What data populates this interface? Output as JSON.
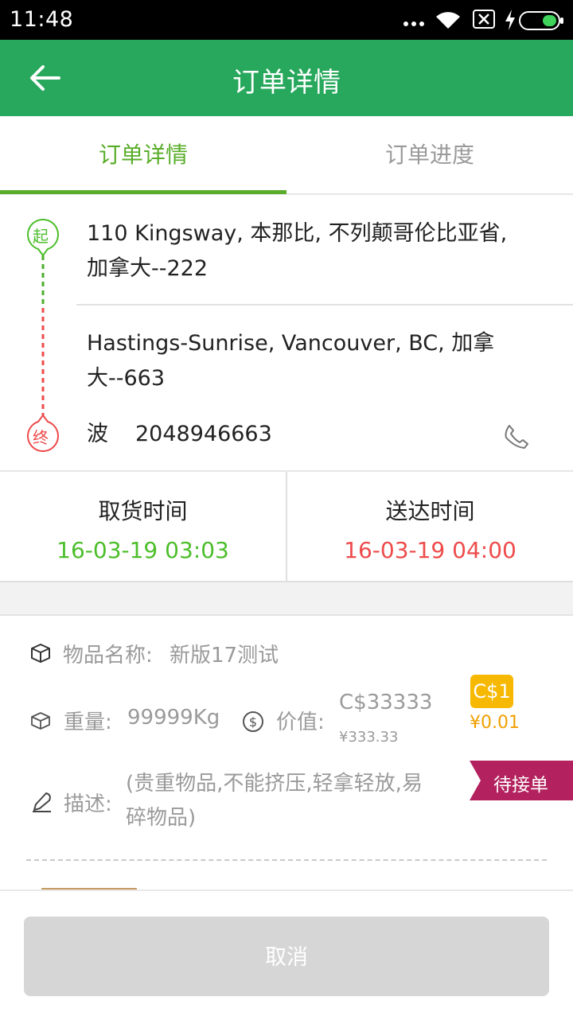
{
  "status_bar": {
    "time": "11:48"
  },
  "header": {
    "title": "订单详情"
  },
  "tabs": [
    {
      "label": "订单详情",
      "active": true
    },
    {
      "label": "订单进度",
      "active": false
    }
  ],
  "route": {
    "start_marker": "起",
    "end_marker": "终",
    "pickup_address": [
      "110 Kingsway, 本那比, 不列颠哥伦比亚省,",
      "加拿大--222"
    ],
    "delivery_address": [
      "Hastings-Sunrise, Vancouver, BC, 加拿",
      "大--663"
    ],
    "contact_name": "波",
    "contact_phone": "2048946663"
  },
  "times": {
    "pickup_label": "取货时间",
    "pickup_value": "16-03-19 03:03",
    "delivery_label": "送达时间",
    "delivery_value": "16-03-19 04:00"
  },
  "item": {
    "name_label": "物品名称:",
    "name_value": "新版17测试",
    "weight_label": "重量:",
    "weight_value": "99999Kg",
    "value_label": "价值:",
    "value_cad": "C$33333",
    "value_cny": "¥333.33",
    "fee_cad": "C$1",
    "fee_cny": "¥0.01",
    "desc_label": "描述:",
    "desc_lines": [
      "(贵重物品,不能挤压,轻拿轻放,易",
      "碎物品)"
    ],
    "status": "待接单"
  },
  "footer": {
    "cancel_label": "取消"
  },
  "colors": {
    "brand_green": "#27a85c",
    "tab_green": "#59ad29",
    "pickup_time": "#4cbe2b",
    "delivery_time": "#ee4b4b",
    "status_tag": "#b3225e",
    "fee_badge": "#f6b800"
  }
}
